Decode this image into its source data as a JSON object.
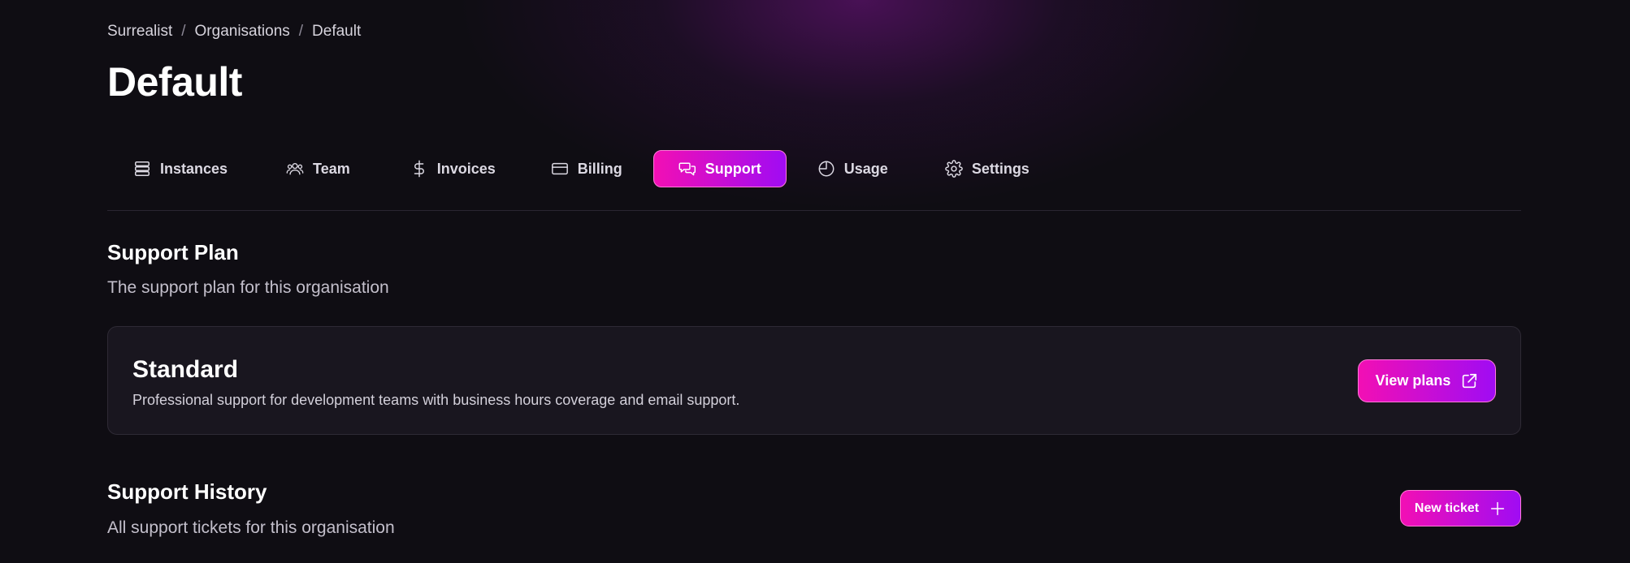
{
  "breadcrumb": {
    "items": [
      "Surrealist",
      "Organisations",
      "Default"
    ],
    "separator": "/"
  },
  "page": {
    "title": "Default"
  },
  "tabs": [
    {
      "label": "Instances",
      "icon": "server-stack-icon"
    },
    {
      "label": "Team",
      "icon": "users-icon"
    },
    {
      "label": "Invoices",
      "icon": "dollar-icon"
    },
    {
      "label": "Billing",
      "icon": "credit-card-icon"
    },
    {
      "label": "Support",
      "icon": "chat-bubbles-icon",
      "active": true
    },
    {
      "label": "Usage",
      "icon": "pie-chart-icon"
    },
    {
      "label": "Settings",
      "icon": "gear-icon"
    }
  ],
  "support_plan": {
    "title": "Support Plan",
    "subtitle": "The support plan for this organisation",
    "plan_name": "Standard",
    "plan_description": "Professional support for development teams with business hours coverage and email support.",
    "view_plans_label": "View plans",
    "view_plans_icon": "external-link-icon"
  },
  "support_history": {
    "title": "Support History",
    "subtitle": "All support tickets for this organisation",
    "new_ticket_label": "New ticket",
    "new_ticket_icon": "plus-icon"
  },
  "colors": {
    "background": "#0f0d13",
    "accent_start": "#f20fb4",
    "accent_end": "#a00cf3",
    "card": "#19161f"
  }
}
